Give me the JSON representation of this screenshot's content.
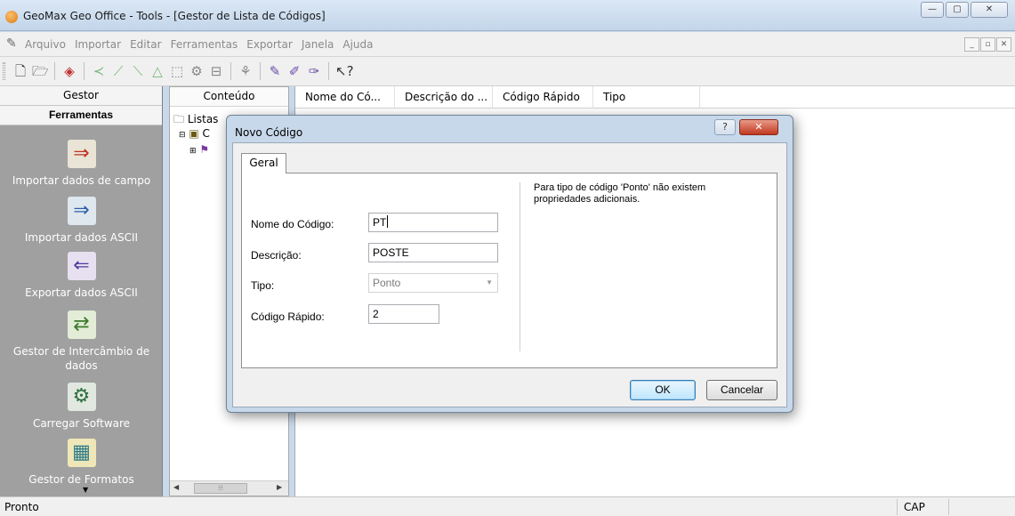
{
  "window": {
    "title": "GeoMax Geo Office - Tools - [Gestor de Lista de Códigos]",
    "controls": {
      "minimize": "—",
      "maximize": "▢",
      "close": "✕"
    }
  },
  "menubar": {
    "items": [
      "Arquivo",
      "Importar",
      "Editar",
      "Ferramentas",
      "Exportar",
      "Janela",
      "Ajuda"
    ],
    "mdi": {
      "minimize": "_",
      "restore": "▫",
      "close": "✕"
    }
  },
  "toolbar": {
    "icons": [
      "new-icon",
      "open-icon",
      "codelist-icon",
      "line-tool-icon",
      "measure-icon",
      "measure2-icon",
      "triangle-icon",
      "layer-icon",
      "settings-icon",
      "window-icon",
      "tree-icon",
      "edit-code-icon",
      "edit-code2-icon",
      "edit-code3-icon",
      "whats-this-icon"
    ]
  },
  "left_panel": {
    "header_gestor": "Gestor",
    "header_ferramentas": "Ferramentas",
    "items": [
      {
        "label": "Importar dados de campo",
        "icon": "import-field-data-icon"
      },
      {
        "label": "Importar dados ASCII",
        "icon": "import-ascii-icon"
      },
      {
        "label": "Exportar dados ASCII",
        "icon": "export-ascii-icon"
      },
      {
        "label": "Gestor de Intercâmbio de dados",
        "icon": "data-exchange-icon"
      },
      {
        "label": "Carregar Software",
        "icon": "load-software-icon"
      },
      {
        "label": "Gestor de Formatos",
        "icon": "format-manager-icon"
      }
    ]
  },
  "tree_panel": {
    "header": "Conteúdo",
    "root_label": "Listas",
    "child_label": "C"
  },
  "main_panel": {
    "columns": [
      "Nome do Có...",
      "Descrição do ...",
      "Código Rápido",
      "Tipo"
    ]
  },
  "dialog": {
    "title": "Novo Código",
    "help": "?",
    "close": "✕",
    "tab": "Geral",
    "fields": {
      "name_label": "Nome do Código:",
      "name_value": "PT",
      "desc_label": "Descrição:",
      "desc_value": "POSTE",
      "type_label": "Tipo:",
      "type_value": "Ponto",
      "quick_label": "Código Rápido:",
      "quick_value": "2"
    },
    "info": "Para tipo de código 'Ponto' não existem propriedades adicionais.",
    "ok": "OK",
    "cancel": "Cancelar"
  },
  "statusbar": {
    "left": "Pronto",
    "cap": "CAP"
  }
}
